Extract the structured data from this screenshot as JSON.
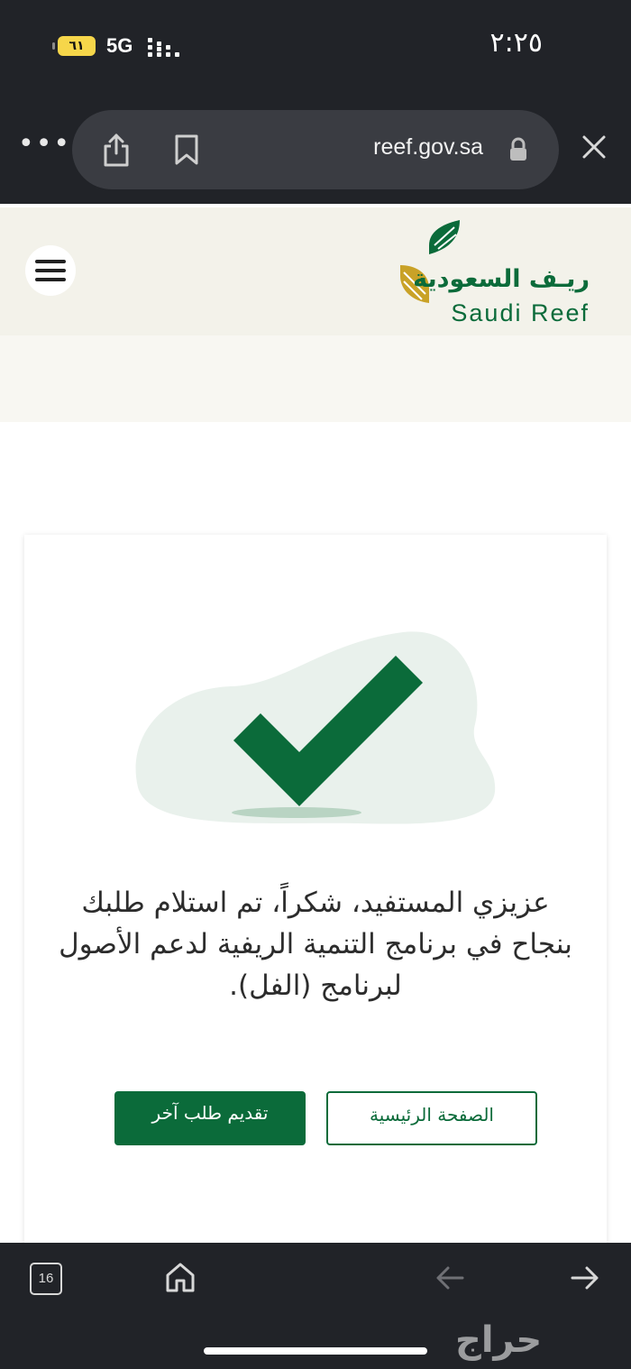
{
  "status_bar": {
    "time": "٢:٢٥",
    "battery": "٦١",
    "network": "5G"
  },
  "browser": {
    "url": "reef.gov.sa",
    "tab_count": "16"
  },
  "site": {
    "logo_ar": "ريـف السعودية",
    "logo_en": "Saudi Reef",
    "brand_color": "#0b6b3a",
    "accent_color": "#c9a227"
  },
  "confirmation": {
    "message": "عزيزي المستفيد، شكراً، تم استلام طلبك بنجاح في برنامج التنمية الريفية لدعم الأصول لبرنامج (الفل).",
    "primary_button": "تقديم طلب آخر",
    "secondary_button": "الصفحة الرئيسية"
  },
  "watermark": "حراج",
  "icons": [
    "more-icon",
    "share-icon",
    "bookmark-icon",
    "lock-icon",
    "close-icon",
    "menu-icon",
    "checkmark-icon",
    "tabs-icon",
    "home-icon",
    "back-arrow-icon",
    "forward-arrow-icon"
  ]
}
